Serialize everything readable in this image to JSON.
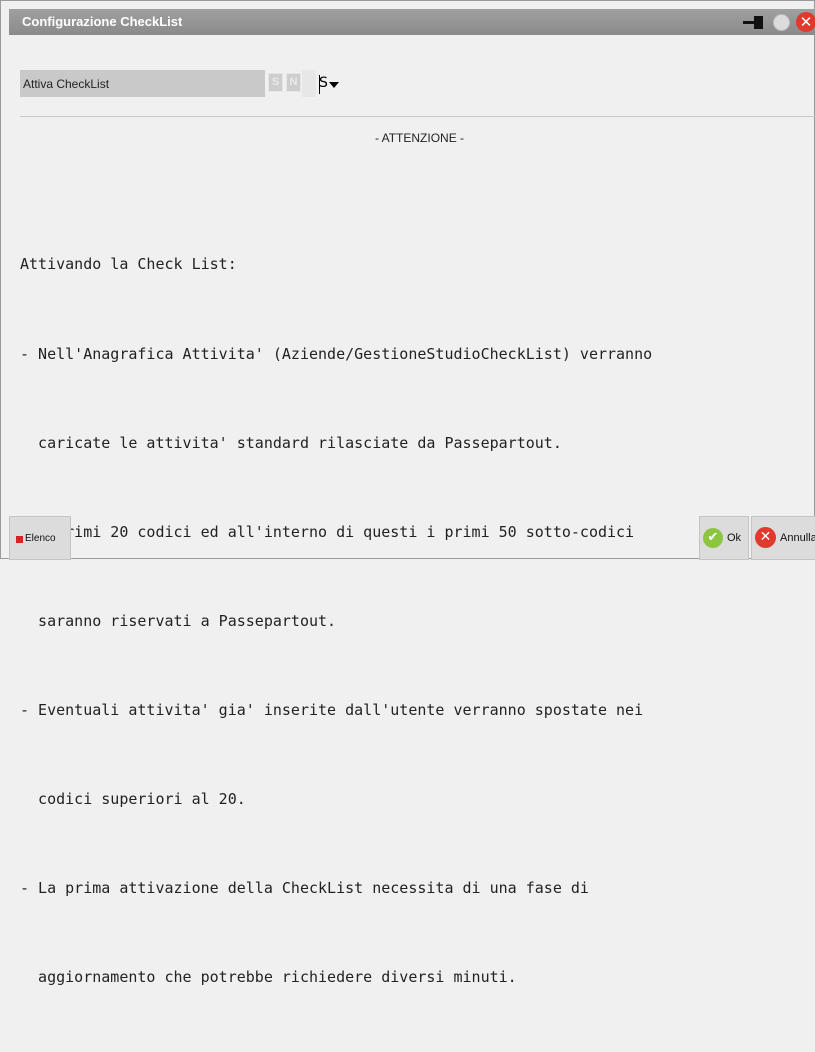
{
  "window": {
    "title": "Configurazione CheckList",
    "title_icons": [
      "pin-icon",
      "minimize-circle-icon",
      "close-icon"
    ],
    "close_glyph": "✕"
  },
  "form": {
    "field_label": "Attiva CheckList",
    "option_s": "S",
    "option_n": "N",
    "combo_value": "S"
  },
  "notice": {
    "heading": "- ATTENZIONE -",
    "lines": [
      "Attivando la Check List:",
      "- Nell'Anagrafica Attivita' (Aziende/GestioneStudioCheckList) verranno",
      "  caricate le attivita' standard rilasciate da Passepartout.",
      "- I primi 20 codici ed all'interno di questi i primi 50 sotto-codici",
      "  saranno riservati a Passepartout.",
      "- Eventuali attivita' gia' inserite dall'utente verranno spostate nei",
      "  codici superiori al 20.",
      "- La prima attivazione della CheckList necessita di una fase di",
      "  aggiornamento che potrebbe richiedere diversi minuti."
    ]
  },
  "footer": {
    "elenco_label": "Elenco",
    "ok_label": "Ok",
    "ok_glyph": "✔",
    "annulla_label": "Annulla",
    "annulla_glyph": "✕"
  },
  "colors": {
    "titlebar": "#8e8e8e",
    "close_red": "#e03a2f",
    "ok_green": "#8cc63f"
  }
}
